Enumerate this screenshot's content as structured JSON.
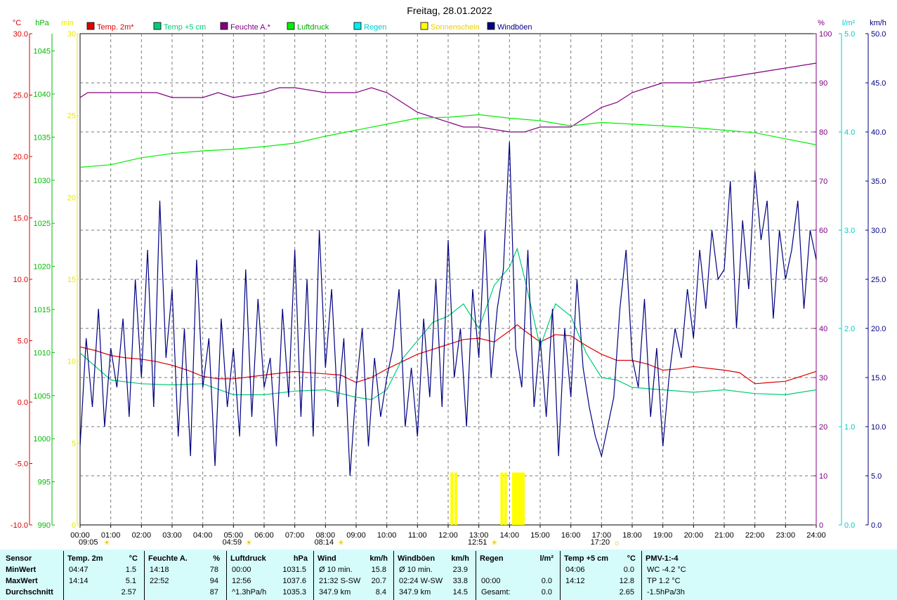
{
  "chart_data": {
    "type": "line",
    "title": "Freitag, 28.01.2022",
    "x_ticks": [
      "00:00",
      "01:00",
      "02:00",
      "03:00",
      "04:00",
      "05:00",
      "06:00",
      "07:00",
      "08:00",
      "09:00",
      "10:00",
      "11:00",
      "12:00",
      "13:00",
      "14:00",
      "15:00",
      "16:00",
      "17:00",
      "18:00",
      "19:00",
      "20:00",
      "21:00",
      "22:00",
      "23:00",
      "24:00"
    ],
    "axes": {
      "temp": {
        "unit": "°C",
        "color": "#dd0000",
        "min": -10,
        "max": 30,
        "ticks": [
          "-10.0",
          "-5.0",
          "0.0",
          "5.0",
          "10.0",
          "15.0",
          "20.0",
          "25.0",
          "30.0"
        ]
      },
      "pressure": {
        "unit": "hPa",
        "color": "#00bb00",
        "min": 990,
        "max": 1047,
        "ticks": [
          "990",
          "995",
          "1000",
          "1005",
          "1010",
          "1015",
          "1020",
          "1025",
          "1030",
          "1035",
          "1040",
          "1045"
        ]
      },
      "sun": {
        "unit": "min",
        "color": "#e8e800",
        "min": 0,
        "max": 30,
        "ticks": [
          "0",
          "5",
          "10",
          "15",
          "20",
          "25",
          "30"
        ]
      },
      "humidity": {
        "unit": "%",
        "color": "#800080",
        "min": 0,
        "max": 100,
        "ticks": [
          "0",
          "10",
          "20",
          "30",
          "40",
          "50",
          "60",
          "70",
          "80",
          "90",
          "100"
        ]
      },
      "rain": {
        "unit": "l/m²",
        "color": "#00cccc",
        "min": 0,
        "max": 5,
        "ticks": [
          "0.0",
          "1.0",
          "2.0",
          "3.0",
          "4.0",
          "5.0"
        ]
      },
      "wind": {
        "unit": "km/h",
        "color": "#000080",
        "min": 0,
        "max": 50,
        "ticks": [
          "0.0",
          "5.0",
          "10.0",
          "15.0",
          "20.0",
          "25.0",
          "30.0",
          "35.0",
          "40.0",
          "45.0",
          "50.0"
        ]
      }
    },
    "legend": [
      {
        "name": "Temp. 2m*",
        "color": "#dd0000"
      },
      {
        "name": "Temp +5 cm",
        "color": "#00cc77"
      },
      {
        "name": "Feuchte A.*",
        "color": "#800080"
      },
      {
        "name": "Luftdruck",
        "color": "#00ee00"
      },
      {
        "name": "Regen",
        "color": "#00eeee"
      },
      {
        "name": "Sonnenschein",
        "color": "#ffff00"
      },
      {
        "name": "Windböen",
        "color": "#000080"
      }
    ],
    "legend_placement": "top",
    "grid": true,
    "markers": [
      {
        "label": "09:05",
        "hour": 0,
        "glyph": "☀"
      },
      {
        "label": "04:59",
        "hour": 5,
        "glyph": "☀"
      },
      {
        "label": "08:14",
        "hour": 8,
        "glyph": "☀"
      },
      {
        "label": "12:51",
        "hour": 13,
        "glyph": "☀"
      },
      {
        "label": "17:20",
        "hour": 17,
        "glyph": "☼"
      }
    ],
    "series": [
      {
        "name": "Temp. 2m*",
        "axis": "temp",
        "color": "#dd0000",
        "x": [
          0,
          0.5,
          1,
          1.5,
          2,
          2.5,
          3,
          3.5,
          4,
          4.5,
          5,
          6,
          7,
          8,
          8.5,
          9,
          9.5,
          10,
          10.5,
          11,
          11.5,
          12,
          12.5,
          13,
          13.5,
          14,
          14.25,
          14.5,
          15,
          15.5,
          16,
          16.5,
          17,
          17.5,
          18,
          18.5,
          19,
          19.5,
          20,
          21,
          21.5,
          22,
          22.5,
          23,
          23.5,
          24
        ],
        "y": [
          4.5,
          4.2,
          3.8,
          3.6,
          3.5,
          3.3,
          3.0,
          2.6,
          2.1,
          1.9,
          1.9,
          2.2,
          2.5,
          2.3,
          2.2,
          1.6,
          2.0,
          2.7,
          3.3,
          3.9,
          4.3,
          4.7,
          5.1,
          5.2,
          4.9,
          5.8,
          6.3,
          5.8,
          4.9,
          5.5,
          5.4,
          4.6,
          3.9,
          3.4,
          3.4,
          3.1,
          2.6,
          2.7,
          2.9,
          2.6,
          2.4,
          1.5,
          1.6,
          1.7,
          2.1,
          2.5
        ]
      },
      {
        "name": "Feuchte A.*",
        "axis": "humidity",
        "color": "#800080",
        "x": [
          0,
          0.25,
          0.5,
          1,
          2,
          2.5,
          3,
          4,
          4.5,
          5,
          6,
          6.5,
          7,
          8,
          9,
          9.5,
          10,
          10.5,
          11,
          11.5,
          12,
          12.5,
          13,
          14,
          14.5,
          15,
          15.5,
          16,
          16.5,
          17,
          17.5,
          18,
          18.5,
          19,
          20,
          21,
          22,
          23,
          24
        ],
        "y": [
          87,
          88,
          88,
          88,
          88,
          88,
          87,
          87,
          88,
          87,
          88,
          89,
          89,
          88,
          88,
          89,
          88,
          86,
          84,
          83,
          82,
          81,
          81,
          80,
          80,
          81,
          81,
          81,
          83,
          85,
          86,
          88,
          89,
          90,
          90,
          91,
          92,
          93,
          94
        ]
      },
      {
        "name": "Luftdruck",
        "axis": "pressure",
        "color": "#00ee00",
        "x": [
          0,
          1,
          2,
          3,
          4,
          5,
          6,
          7,
          8,
          9,
          10,
          11,
          12,
          13,
          14,
          15,
          16,
          17,
          18,
          19,
          20,
          21,
          22,
          23,
          24
        ],
        "y": [
          1031.5,
          1031.8,
          1032.6,
          1033.1,
          1033.4,
          1033.6,
          1033.9,
          1034.3,
          1035.1,
          1035.8,
          1036.5,
          1037.2,
          1037.3,
          1037.6,
          1037.2,
          1036.9,
          1036.3,
          1036.7,
          1036.5,
          1036.3,
          1036.1,
          1035.8,
          1035.5,
          1034.8,
          1034.1
        ]
      },
      {
        "name": "Temp +5 cm",
        "axis": "temp",
        "color": "#00cc77",
        "x": [
          0,
          1,
          2,
          3,
          4,
          5,
          6,
          7,
          8,
          9,
          9.5,
          10,
          10.5,
          11,
          11.5,
          12,
          12.5,
          13,
          13.5,
          14,
          14.25,
          14.5,
          15,
          15.5,
          16,
          16.5,
          17,
          17.5,
          18,
          19,
          20,
          21,
          22,
          23,
          24
        ],
        "y": [
          4.0,
          1.8,
          1.5,
          1.4,
          1.5,
          0.6,
          0.6,
          0.9,
          1.0,
          0.4,
          0.2,
          1.0,
          3.5,
          5.0,
          6.5,
          7.0,
          8.0,
          6.0,
          9.5,
          11.0,
          12.5,
          10.0,
          4.5,
          8.0,
          7.0,
          4.0,
          2.0,
          1.8,
          1.2,
          1.0,
          0.8,
          1.0,
          0.7,
          0.6,
          1.0
        ]
      },
      {
        "name": "Windböen",
        "axis": "wind",
        "color": "#000080",
        "x": [
          0,
          0.2,
          0.4,
          0.6,
          0.8,
          1,
          1.2,
          1.4,
          1.6,
          1.8,
          2,
          2.2,
          2.4,
          2.6,
          2.8,
          3,
          3.2,
          3.4,
          3.6,
          3.8,
          4,
          4.2,
          4.4,
          4.6,
          4.8,
          5,
          5.2,
          5.4,
          5.6,
          5.8,
          6,
          6.2,
          6.4,
          6.6,
          6.8,
          7,
          7.2,
          7.4,
          7.6,
          7.8,
          8,
          8.2,
          8.4,
          8.6,
          8.8,
          9,
          9.2,
          9.4,
          9.6,
          9.8,
          10,
          10.2,
          10.4,
          10.6,
          10.8,
          11,
          11.2,
          11.4,
          11.6,
          11.8,
          12,
          12.2,
          12.4,
          12.6,
          12.8,
          13,
          13.2,
          13.4,
          13.6,
          13.8,
          14,
          14.2,
          14.4,
          14.6,
          14.8,
          15,
          15.2,
          15.4,
          15.6,
          15.8,
          16,
          16.2,
          16.4,
          16.6,
          16.8,
          17,
          17.2,
          17.4,
          17.6,
          17.8,
          18,
          18.2,
          18.4,
          18.6,
          18.8,
          19,
          19.2,
          19.4,
          19.6,
          19.8,
          20,
          20.2,
          20.4,
          20.6,
          20.8,
          21,
          21.2,
          21.4,
          21.6,
          21.8,
          22,
          22.2,
          22.4,
          22.6,
          22.8,
          23,
          23.2,
          23.4,
          23.6,
          23.8,
          24
        ],
        "y": [
          8,
          19,
          12,
          22,
          10,
          18,
          14,
          21,
          11,
          25,
          15,
          28,
          12,
          33,
          17,
          24,
          9,
          20,
          7,
          27,
          14,
          19,
          6,
          21,
          12,
          18,
          9,
          26,
          11,
          23,
          14,
          17,
          8,
          22,
          13,
          28,
          11,
          25,
          9,
          30,
          16,
          24,
          12,
          19,
          5,
          14,
          20,
          8,
          17,
          11,
          15,
          18,
          24,
          10,
          16,
          9,
          21,
          13,
          25,
          12,
          29,
          15,
          20,
          10,
          24,
          17,
          30,
          15,
          22,
          26,
          39,
          18,
          14,
          28,
          12,
          19,
          11,
          22,
          7,
          20,
          13,
          25,
          16,
          12,
          9,
          7,
          10,
          13,
          22,
          28,
          17,
          14,
          23,
          11,
          18,
          8,
          15,
          20,
          17,
          24,
          19,
          28,
          22,
          30,
          25,
          26,
          35,
          20,
          31,
          24,
          36,
          29,
          33,
          21,
          30,
          25,
          28,
          33,
          22,
          30,
          27
        ]
      }
    ],
    "sunshine_bars": [
      {
        "hour": 12.12,
        "value": 3.2
      },
      {
        "hour": 12.25,
        "value": 3.2
      },
      {
        "hour": 13.75,
        "value": 3.2
      },
      {
        "hour": 13.87,
        "value": 3.2
      },
      {
        "hour": 14.13,
        "value": 3.2
      },
      {
        "hour": 14.22,
        "value": 3.2
      },
      {
        "hour": 14.3,
        "value": 3.2
      },
      {
        "hour": 14.38,
        "value": 3.2
      },
      {
        "hour": 14.45,
        "value": 3.2
      }
    ]
  },
  "stats": {
    "columns": [
      {
        "header": "Sensor",
        "rows": [
          "MinWert",
          "MaxWert",
          "Durchschnitt"
        ]
      },
      {
        "header": "Temp. 2m",
        "unit": "°C",
        "rows": [
          [
            "04:47",
            "1.5"
          ],
          [
            "14:14",
            "5.1"
          ],
          [
            "",
            "2.57"
          ]
        ]
      },
      {
        "header": "Feuchte A.",
        "unit": "%",
        "rows": [
          [
            "14:18",
            "78"
          ],
          [
            "22:52",
            "94"
          ],
          [
            "",
            "87"
          ]
        ]
      },
      {
        "header": "Luftdruck",
        "unit": "hPa",
        "rows": [
          [
            "00:00",
            "1031.5"
          ],
          [
            "12:56",
            "1037.6"
          ],
          [
            "^1.3hPa/h",
            "1035.3"
          ]
        ]
      },
      {
        "header": "Wind",
        "unit": "km/h",
        "rows": [
          [
            "Ø 10 min.",
            "15.8"
          ],
          [
            "21:32   S-SW",
            "20.7"
          ],
          [
            "347.9 km",
            "8.4"
          ]
        ]
      },
      {
        "header": "Windböen",
        "unit": "km/h",
        "rows": [
          [
            "Ø 10 min.",
            "23.9"
          ],
          [
            "02:24   W-SW",
            "33.8"
          ],
          [
            "347.9 km",
            "14.5"
          ]
        ]
      },
      {
        "header": "Regen",
        "unit": "l/m²",
        "rows": [
          [
            "",
            ""
          ],
          [
            "00:00",
            "0.0"
          ],
          [
            "Gesamt:",
            "0.0"
          ]
        ]
      },
      {
        "header": "Temp +5 cm",
        "unit": "°C",
        "rows": [
          [
            "04:06",
            "0.0"
          ],
          [
            "14:12",
            "12.8"
          ],
          [
            "",
            "2.65"
          ]
        ]
      },
      {
        "header": "PMV-1:-4",
        "unit": "",
        "rows": [
          [
            "WC -4.2 °C",
            ""
          ],
          [
            "TP 1.2 °C",
            ""
          ],
          [
            "-1.5hPa/3h",
            ""
          ]
        ]
      }
    ]
  }
}
